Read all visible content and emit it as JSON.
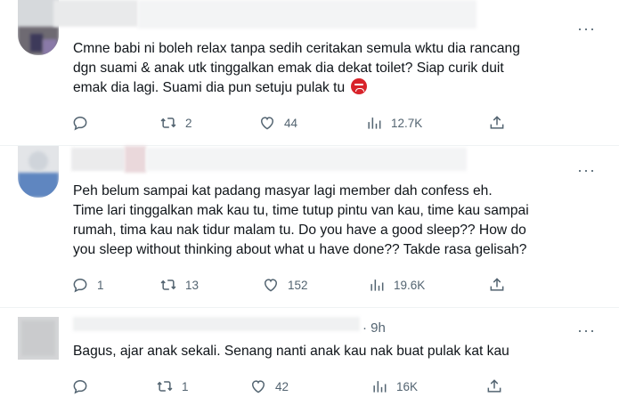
{
  "tweets": [
    {
      "text": "Cmne babi ni boleh relax tanpa sedih ceritakan semula wktu dia rancang\ndgn suami & anak utk tinggalkan emak dia dekat toilet? Siap curik duit\nemak dia lagi. Suami dia pun setuju pulak tu",
      "emoji": "angry-face-emoji",
      "replies": "",
      "retweets": "2",
      "likes": "44",
      "views": "12.7K"
    },
    {
      "text": "Peh belum sampai kat padang masyar lagi member dah confess eh.\nTime lari tinggalkan mak kau tu, time tutup pintu van kau, time kau sampai\nrumah, tima kau nak tidur malam tu. Do you have a good sleep?? How do\nyou sleep without thinking about what u have done?? Takde rasa gelisah?",
      "replies": "1",
      "retweets": "13",
      "likes": "152",
      "views": "19.6K"
    },
    {
      "time": "· 9h",
      "text": "Bagus, ajar anak sekali. Senang nanti anak kau nak buat pulak kat kau",
      "replies": "",
      "retweets": "1",
      "likes": "42",
      "views": "16K"
    }
  ],
  "more_label": "···",
  "colors": {
    "text": "#0f1419",
    "muted": "#536471",
    "divider": "#eff3f4"
  },
  "icons": [
    "reply-icon",
    "retweet-icon",
    "like-icon",
    "views-icon",
    "share-icon",
    "more-icon"
  ]
}
